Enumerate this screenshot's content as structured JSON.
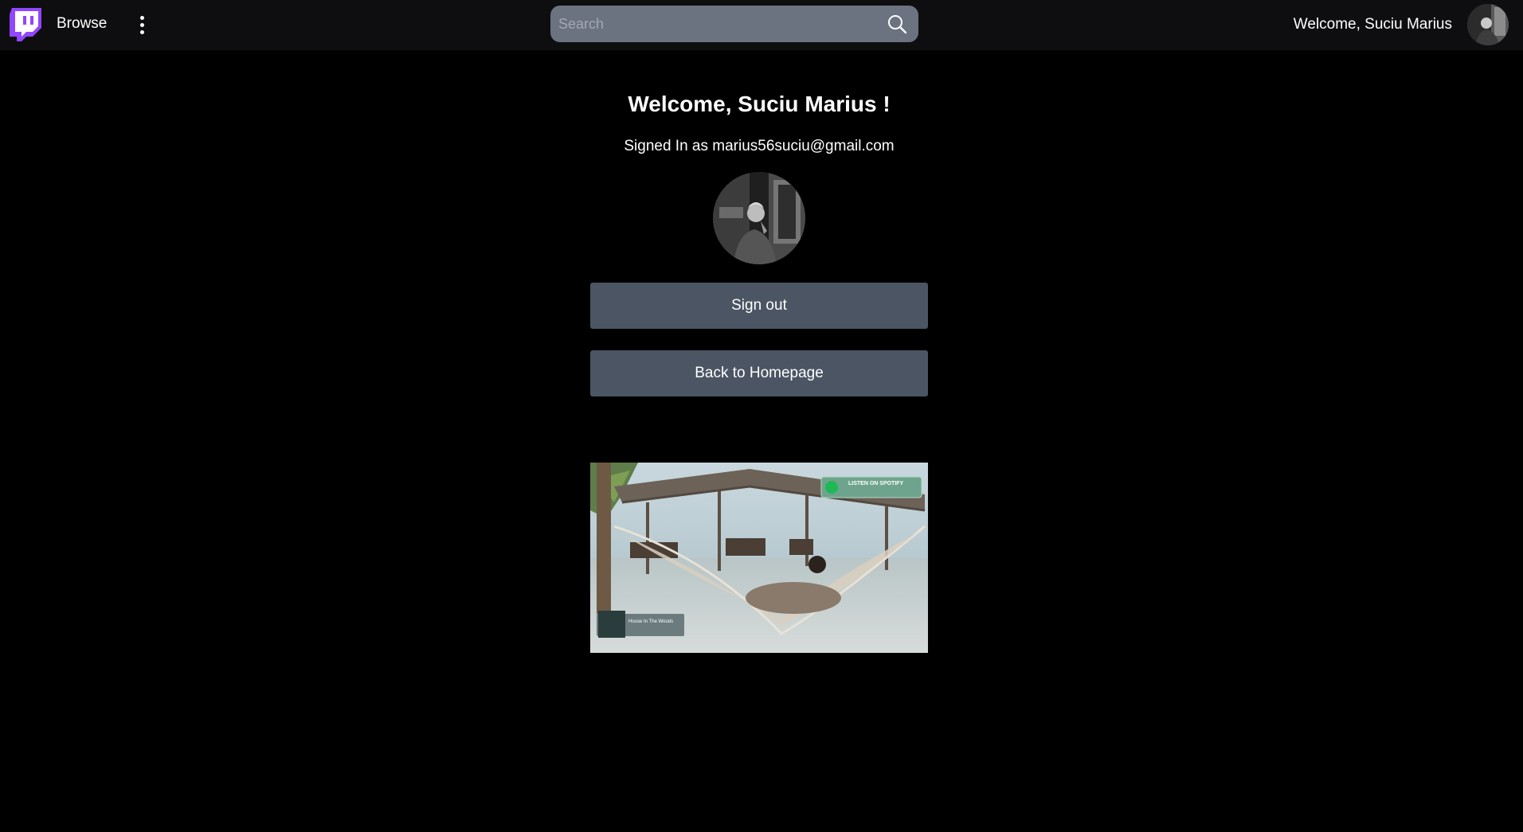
{
  "topbar": {
    "browse_label": "Browse",
    "search": {
      "placeholder": "Search",
      "value": ""
    },
    "welcome_text": "Welcome, Suciu Marius"
  },
  "main": {
    "title": "Welcome, Suciu Marius !",
    "signed_in_text": "Signed In as marius56suciu@gmail.com",
    "signout_label": "Sign out",
    "home_label": "Back to Homepage"
  },
  "video": {
    "spotify_badge": "LISTEN ON SPOTIFY",
    "track_title": "House In The Woods"
  },
  "colors": {
    "topbar_bg": "#0e0e10",
    "brand_purple": "#9146ff",
    "button_bg": "#4b5563",
    "search_bg": "#6b7280",
    "page_bg": "#000000"
  },
  "icons": [
    "twitch-logo-icon",
    "more-vertical-icon",
    "search-icon",
    "avatar"
  ]
}
